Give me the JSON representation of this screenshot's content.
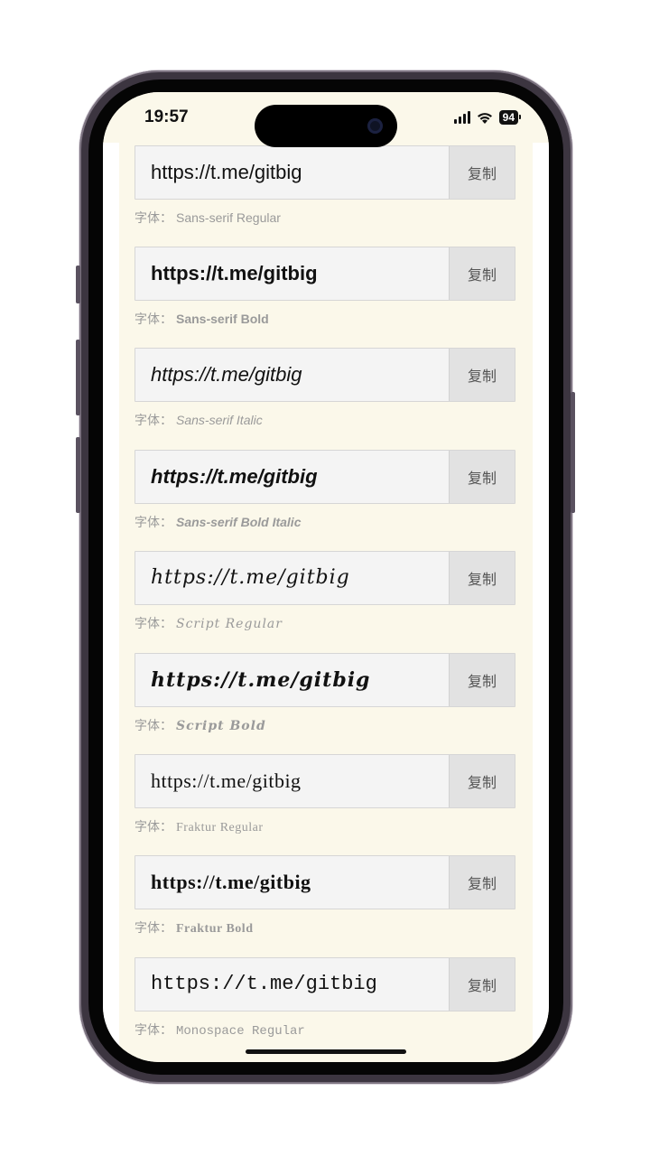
{
  "status_bar": {
    "time": "19:57",
    "battery": "94",
    "signal_icon": "signal-bars-icon",
    "wifi_icon": "wifi-icon"
  },
  "copy_label": "复制",
  "font_prefix": "字体：",
  "items": [
    {
      "text": "https://t.me/gitbig",
      "font": "Sans-serif Regular"
    },
    {
      "text": "https://t.me/gitbig",
      "font": "Sans-serif Bold"
    },
    {
      "text": "https://t.me/gitbig",
      "font": "Sans-serif Italic"
    },
    {
      "text": "https://t.me/gitbig",
      "font": "Sans-serif Bold Italic"
    },
    {
      "text": "https://t.me/gitbig",
      "font": "Script Regular"
    },
    {
      "text": "https://t.me/gitbig",
      "font": "Script Bold"
    },
    {
      "text": "https://t.me/gitbig",
      "font": "Fraktur Regular"
    },
    {
      "text": "https://t.me/gitbig",
      "font": "Fraktur Bold"
    },
    {
      "text": "https://t.me/gitbig",
      "font": "Monospace Regular"
    }
  ]
}
